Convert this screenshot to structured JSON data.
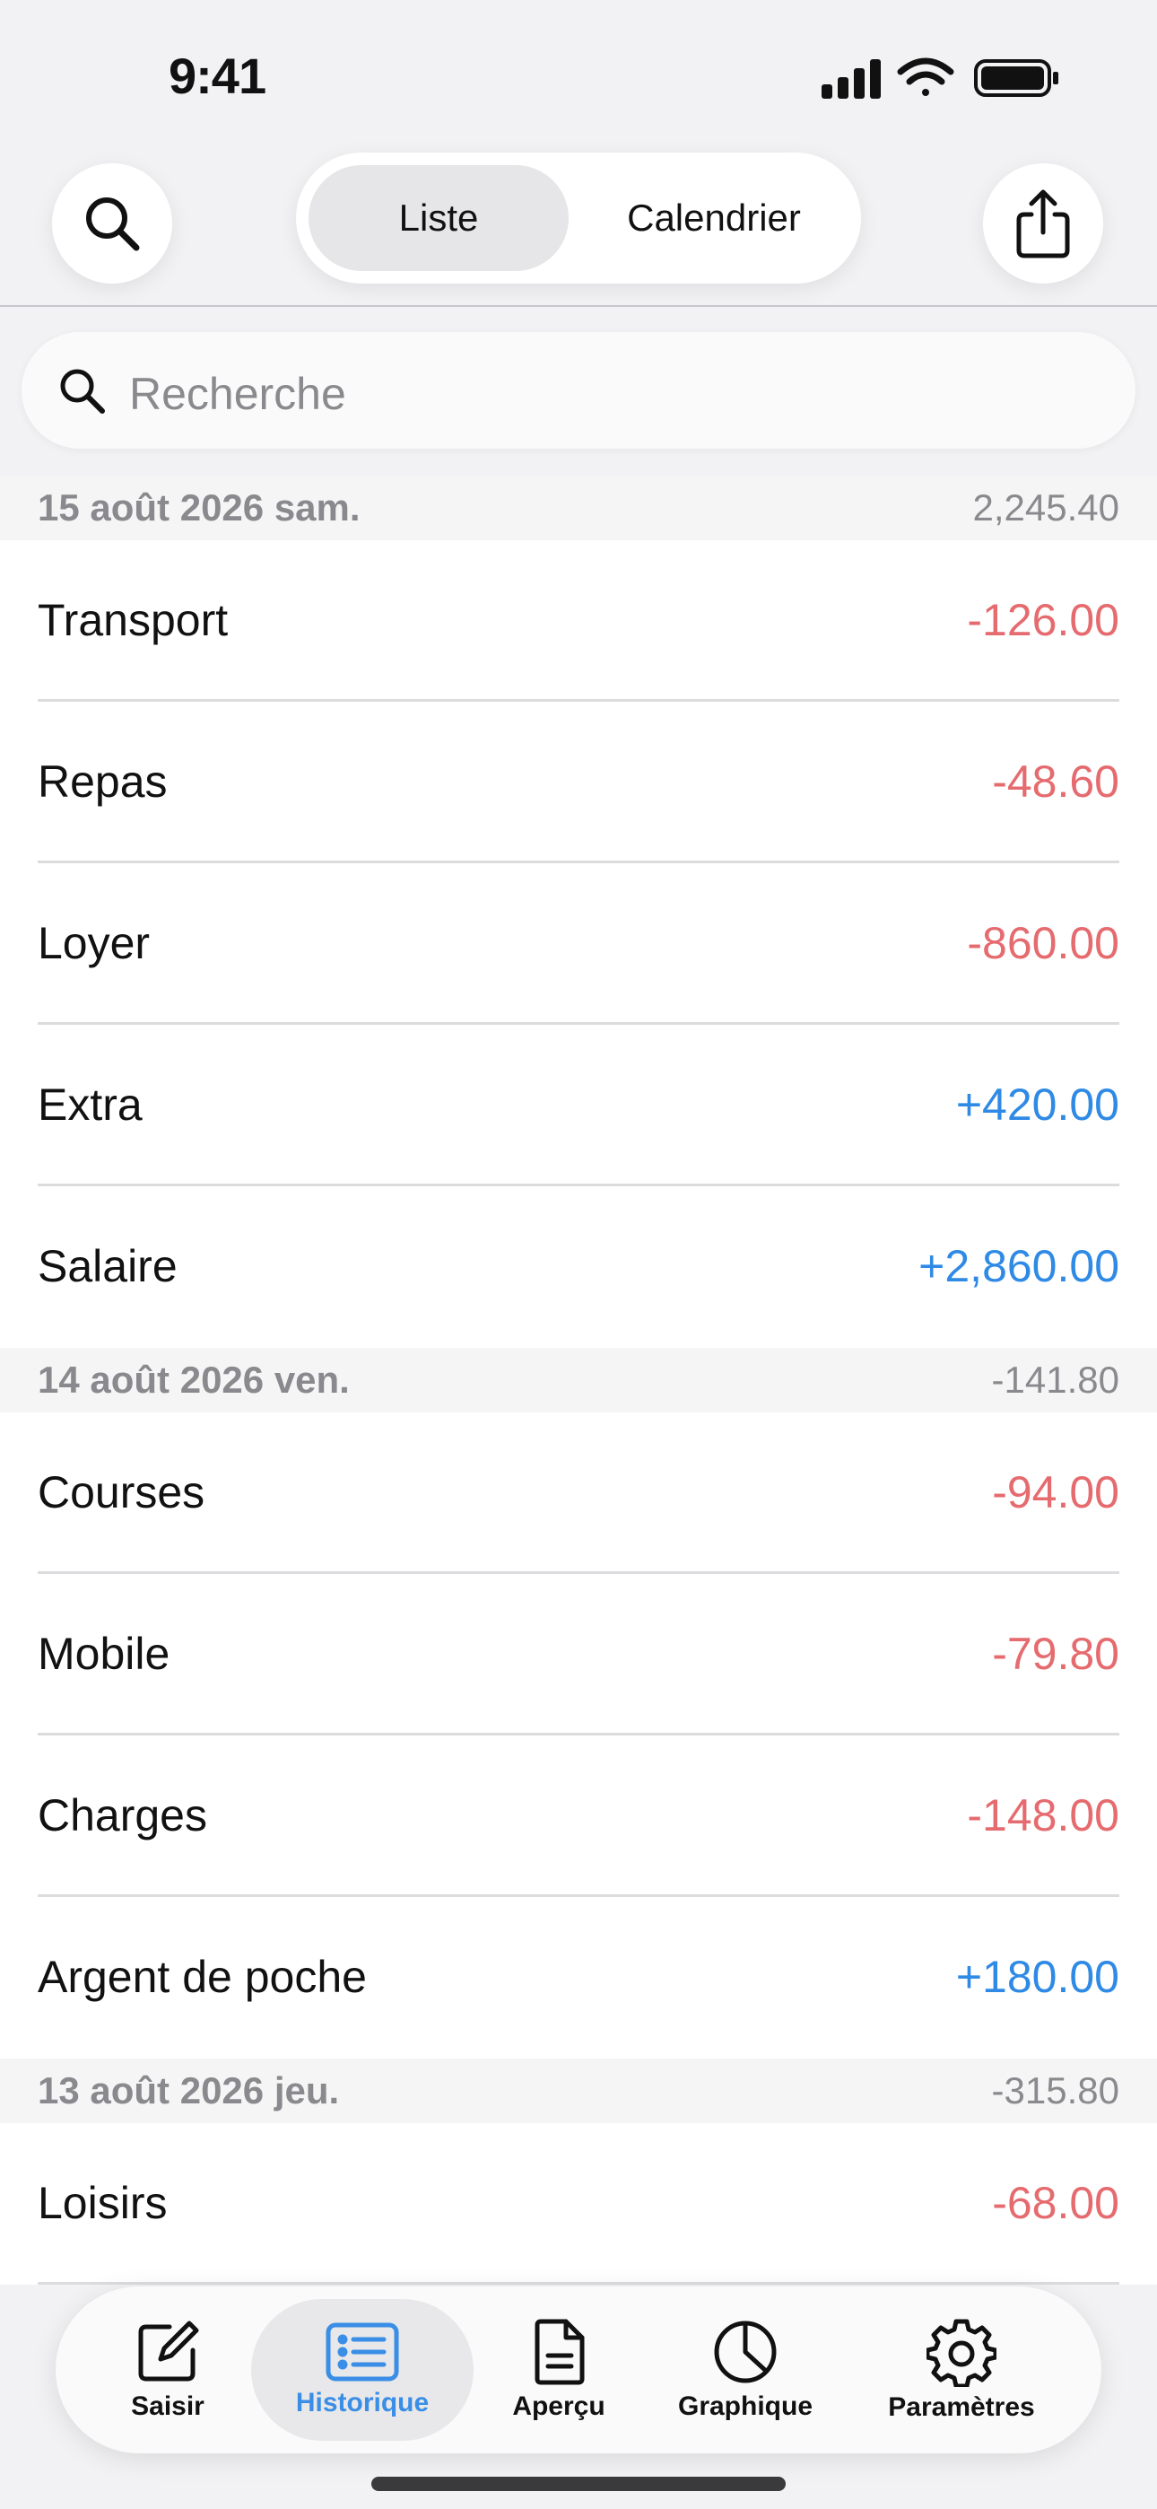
{
  "status_bar": {
    "time": "9:41"
  },
  "nav": {
    "segments": [
      {
        "label": "Liste",
        "active": true
      },
      {
        "label": "Calendrier",
        "active": false
      }
    ]
  },
  "search": {
    "placeholder": "Recherche"
  },
  "sections": [
    {
      "date": "15 août 2026 sam.",
      "total": "2,245.40",
      "rows": [
        {
          "label": "Transport",
          "amount": "-126.00",
          "kind": "neg"
        },
        {
          "label": "Repas",
          "amount": "-48.60",
          "kind": "neg"
        },
        {
          "label": "Loyer",
          "amount": "-860.00",
          "kind": "neg"
        },
        {
          "label": "Extra",
          "amount": "+420.00",
          "kind": "pos"
        },
        {
          "label": "Salaire",
          "amount": "+2,860.00",
          "kind": "pos"
        }
      ]
    },
    {
      "date": "14 août 2026 ven.",
      "total": "-141.80",
      "rows": [
        {
          "label": "Courses",
          "amount": "-94.00",
          "kind": "neg"
        },
        {
          "label": "Mobile",
          "amount": "-79.80",
          "kind": "neg"
        },
        {
          "label": "Charges",
          "amount": "-148.00",
          "kind": "neg"
        },
        {
          "label": "Argent de poche",
          "amount": "+180.00",
          "kind": "pos"
        }
      ]
    },
    {
      "date": "13 août 2026 jeu.",
      "total": "-315.80",
      "rows": [
        {
          "label": "Loisirs",
          "amount": "-68.00",
          "kind": "neg"
        }
      ]
    }
  ],
  "tab_bar": {
    "tabs": [
      {
        "label": "Saisir",
        "icon": "compose-icon",
        "active": false
      },
      {
        "label": "Historique",
        "icon": "list-icon",
        "active": true
      },
      {
        "label": "Aperçu",
        "icon": "document-icon",
        "active": false
      },
      {
        "label": "Graphique",
        "icon": "pie-chart-icon",
        "active": false
      },
      {
        "label": "Paramètres",
        "icon": "gear-icon",
        "active": false
      }
    ]
  },
  "colors": {
    "negative": "#e56b6f",
    "positive": "#2f8ae5",
    "accent": "#3a8ee6"
  }
}
